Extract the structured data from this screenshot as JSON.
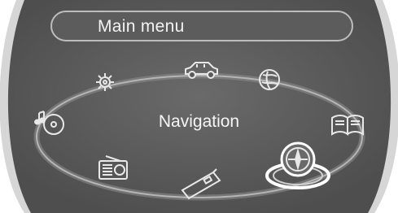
{
  "header": {
    "title": "Main menu"
  },
  "center": {
    "label": "Navigation"
  },
  "menu_items": [
    {
      "name": "settings",
      "icon": "gear-icon"
    },
    {
      "name": "vehicle-info",
      "icon": "car-icon"
    },
    {
      "name": "online",
      "icon": "globe-icon"
    },
    {
      "name": "entertainment",
      "icon": "music-cd-icon"
    },
    {
      "name": "owners-manual",
      "icon": "book-icon"
    },
    {
      "name": "radio",
      "icon": "radio-icon"
    },
    {
      "name": "telephone",
      "icon": "phone-icon"
    },
    {
      "name": "navigation",
      "icon": "compass-icon",
      "selected": true
    }
  ],
  "colors": {
    "screen_background": "#5a5a5a",
    "bezel": "#cfcfcf",
    "icon_stroke": "#e8e8e8",
    "text": "#f2f2f2"
  }
}
